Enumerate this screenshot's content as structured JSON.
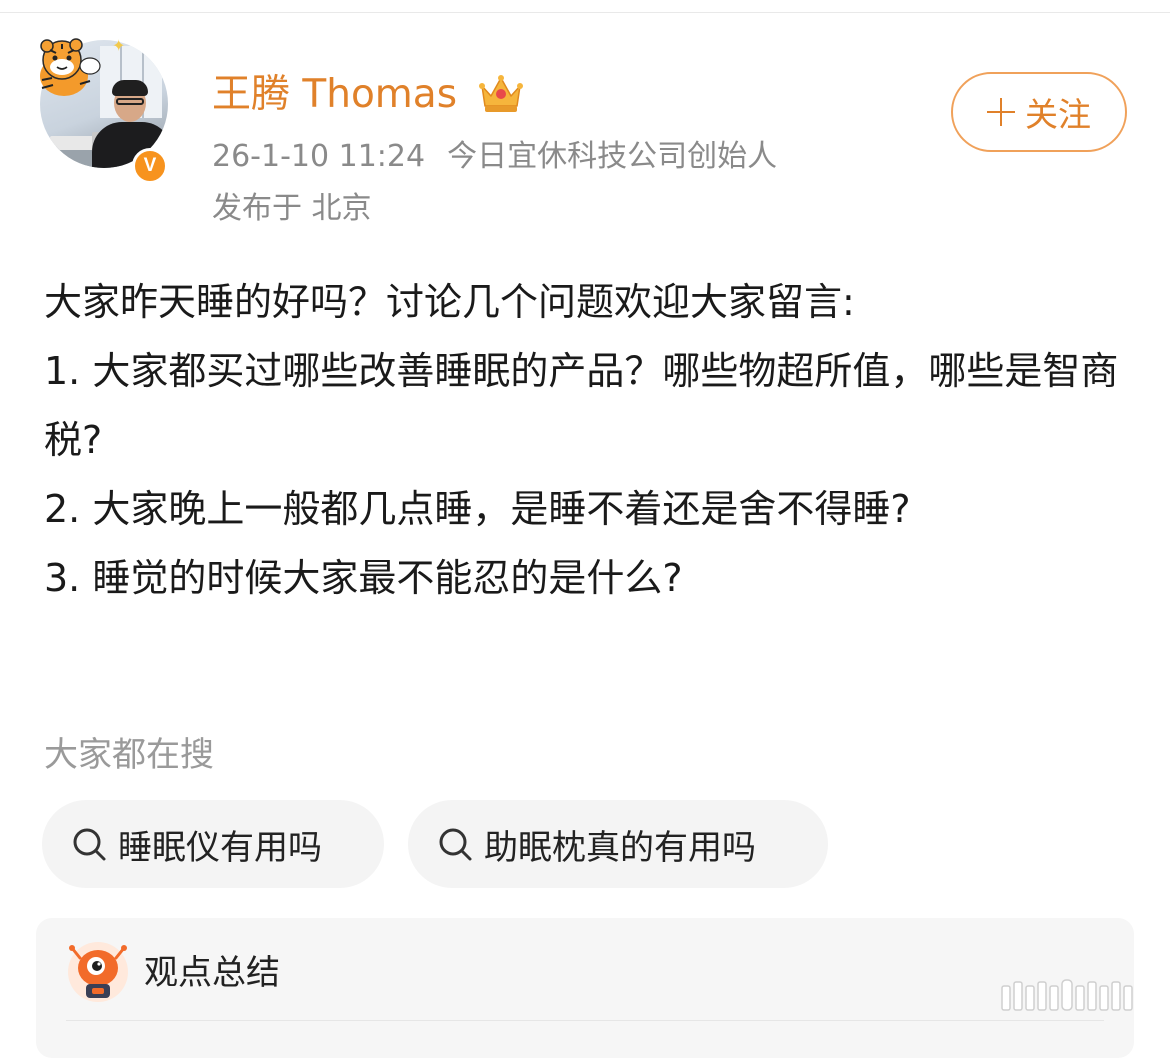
{
  "author": {
    "name": "王腾 Thomas",
    "posted_at": "26-1-10 11:24",
    "bio": "今日宜休科技公司创始人",
    "location": "发布于 北京",
    "verified_badge": "V",
    "follow_label": "关注"
  },
  "post": {
    "paragraphs": [
      "大家昨天睡的好吗？讨论几个问题欢迎大家留言:",
      "1. 大家都买过哪些改善睡眠的产品？哪些物超所值，哪些是智商税?",
      "2. 大家晚上一般都几点睡，是睡不着还是舍不得睡?",
      "3. 睡觉的时候大家最不能忍的是什么?"
    ]
  },
  "trending_search": {
    "title": "大家都在搜",
    "items": [
      {
        "label": "睡眠仪有用吗",
        "icon": "search-icon"
      },
      {
        "label": "助眠枕真的有用吗",
        "icon": "search-icon"
      }
    ]
  },
  "summary": {
    "title": "观点总结",
    "icon": "mascot-icon"
  },
  "colors": {
    "accent": "#e0812a",
    "muted_text": "#8a8a8a",
    "chip_background": "#f4f4f4",
    "panel_background": "#f6f6f6"
  }
}
